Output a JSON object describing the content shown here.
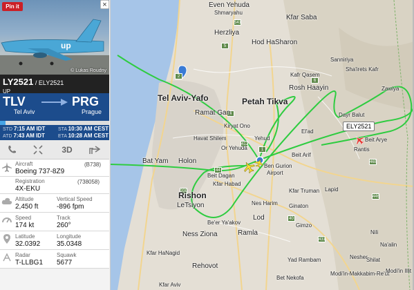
{
  "photo": {
    "pin_label": "Pin it",
    "credit": "© Lukas Roudny",
    "jet_color": "#4aa7d6"
  },
  "close_label": "×",
  "flight": {
    "number": "LY2521",
    "separator": " / ",
    "callsign": "ELY2521",
    "airline_code": "UP"
  },
  "route": {
    "from_code": "TLV",
    "from_city": "Tel Aviv",
    "to_code": "PRG",
    "to_city": "Prague",
    "progress_fraction": 0.05
  },
  "times": {
    "std_label": "STD",
    "std": "7:15 AM IDT",
    "atd_label": "ATD",
    "atd": "7:43 AM IDT",
    "sta_label": "STA",
    "sta": "10:30 AM CEST",
    "eta_label": "ETA",
    "eta": "10:28 AM CEST"
  },
  "toolbar": {
    "phone_icon": "phone-icon",
    "expand_icon": "expand-icon",
    "three_d_label": "3D",
    "share_icon": "share-icon"
  },
  "details": {
    "aircraft_label": "Aircraft",
    "aircraft_code": "(B738)",
    "aircraft": "Boeing 737-8Z9",
    "registration_label": "Registration",
    "registration_code": "(738058)",
    "registration": "4X-EKU",
    "altitude_label": "Altitude",
    "altitude": "2,450 ft",
    "vspeed_label": "Vertical Speed",
    "vspeed": "-896 fpm",
    "speed_label": "Speed",
    "speed": "174 kt",
    "track_label": "Track",
    "track": "260°",
    "latitude_label": "Latitude",
    "latitude": "32.0392",
    "longitude_label": "Longitude",
    "longitude": "35.0348",
    "radar_label": "Radar",
    "radar": "T-LLBG1",
    "squawk_label": "Squawk",
    "squawk": "5677"
  },
  "map": {
    "aircraft_tag": "ELY2521",
    "track_color": "#2ecc40",
    "places": {
      "even_yehuda": "Even Yehuda",
      "shmaryahu": "Shmaryahu",
      "kfar_saba": "Kfar Saba",
      "herzliya": "Herzliya",
      "hod_hasharon": "Hod HaSharon",
      "tel_aviv": "Tel Aviv-Yafo",
      "ramat_gan": "Ramat Gan",
      "petah_tikva": "Petah Tikva",
      "rosh_haayin": "Rosh Haayin",
      "kafr_qasem": "Kafr Qasem",
      "sha_irets": "Sha'irets Kafr",
      "sanniriya": "Sanniriya",
      "zawiya": "Zawiya",
      "kiryat_ono": "Kiryat Ono",
      "el_ad": "El'ad",
      "havat_shilem": "Havat Shilem",
      "or_yehuda": "Or Yehuda",
      "yehud": "Yehud",
      "ben_gurion": "Ben Gurion",
      "airport": "Airport",
      "bat_yam": "Bat Yam",
      "holon": "Holon",
      "beit_dagan": "Beit Dagan",
      "kfar_habad": "Kfar Habad",
      "beit_arif": "Beit Arif",
      "lapid": "Lapid",
      "dayr_balut": "Dayr Balut",
      "beit_arye": "Beit Arye",
      "rantis": "Rantis",
      "rishon": "Rishon",
      "letziyon": "LeTsiyon",
      "be_er_yaakov": "Be'er Ya'akov",
      "lod": "Lod",
      "ginaton": "Ginaton",
      "kfar_truman": "Kfar Truman",
      "gimzo": "Gimzo",
      "nes_harim": "Nes Harim",
      "ness_ziona": "Ness Ziona",
      "ramla": "Ramla",
      "rehovot": "Rehovot",
      "yad_rambam": "Yad Rambam",
      "modiin": "Modi'in-Makkabim-Re'ut",
      "kfar_hanagid": "Kfar HaNagid",
      "kfar_aviv": "Kfar Aviv",
      "na_alin": "Na'alin",
      "nili": "Nili",
      "shilat": "Shilat",
      "bet_nekofa": "Bet Nekofa",
      "nesher": "Nesher",
      "modiin_illit": "Modi'in Illit"
    },
    "roads": [
      "541",
      "2",
      "5",
      "4",
      "412",
      "1",
      "44",
      "6",
      "465",
      "40",
      "431",
      "446",
      "200"
    ]
  }
}
